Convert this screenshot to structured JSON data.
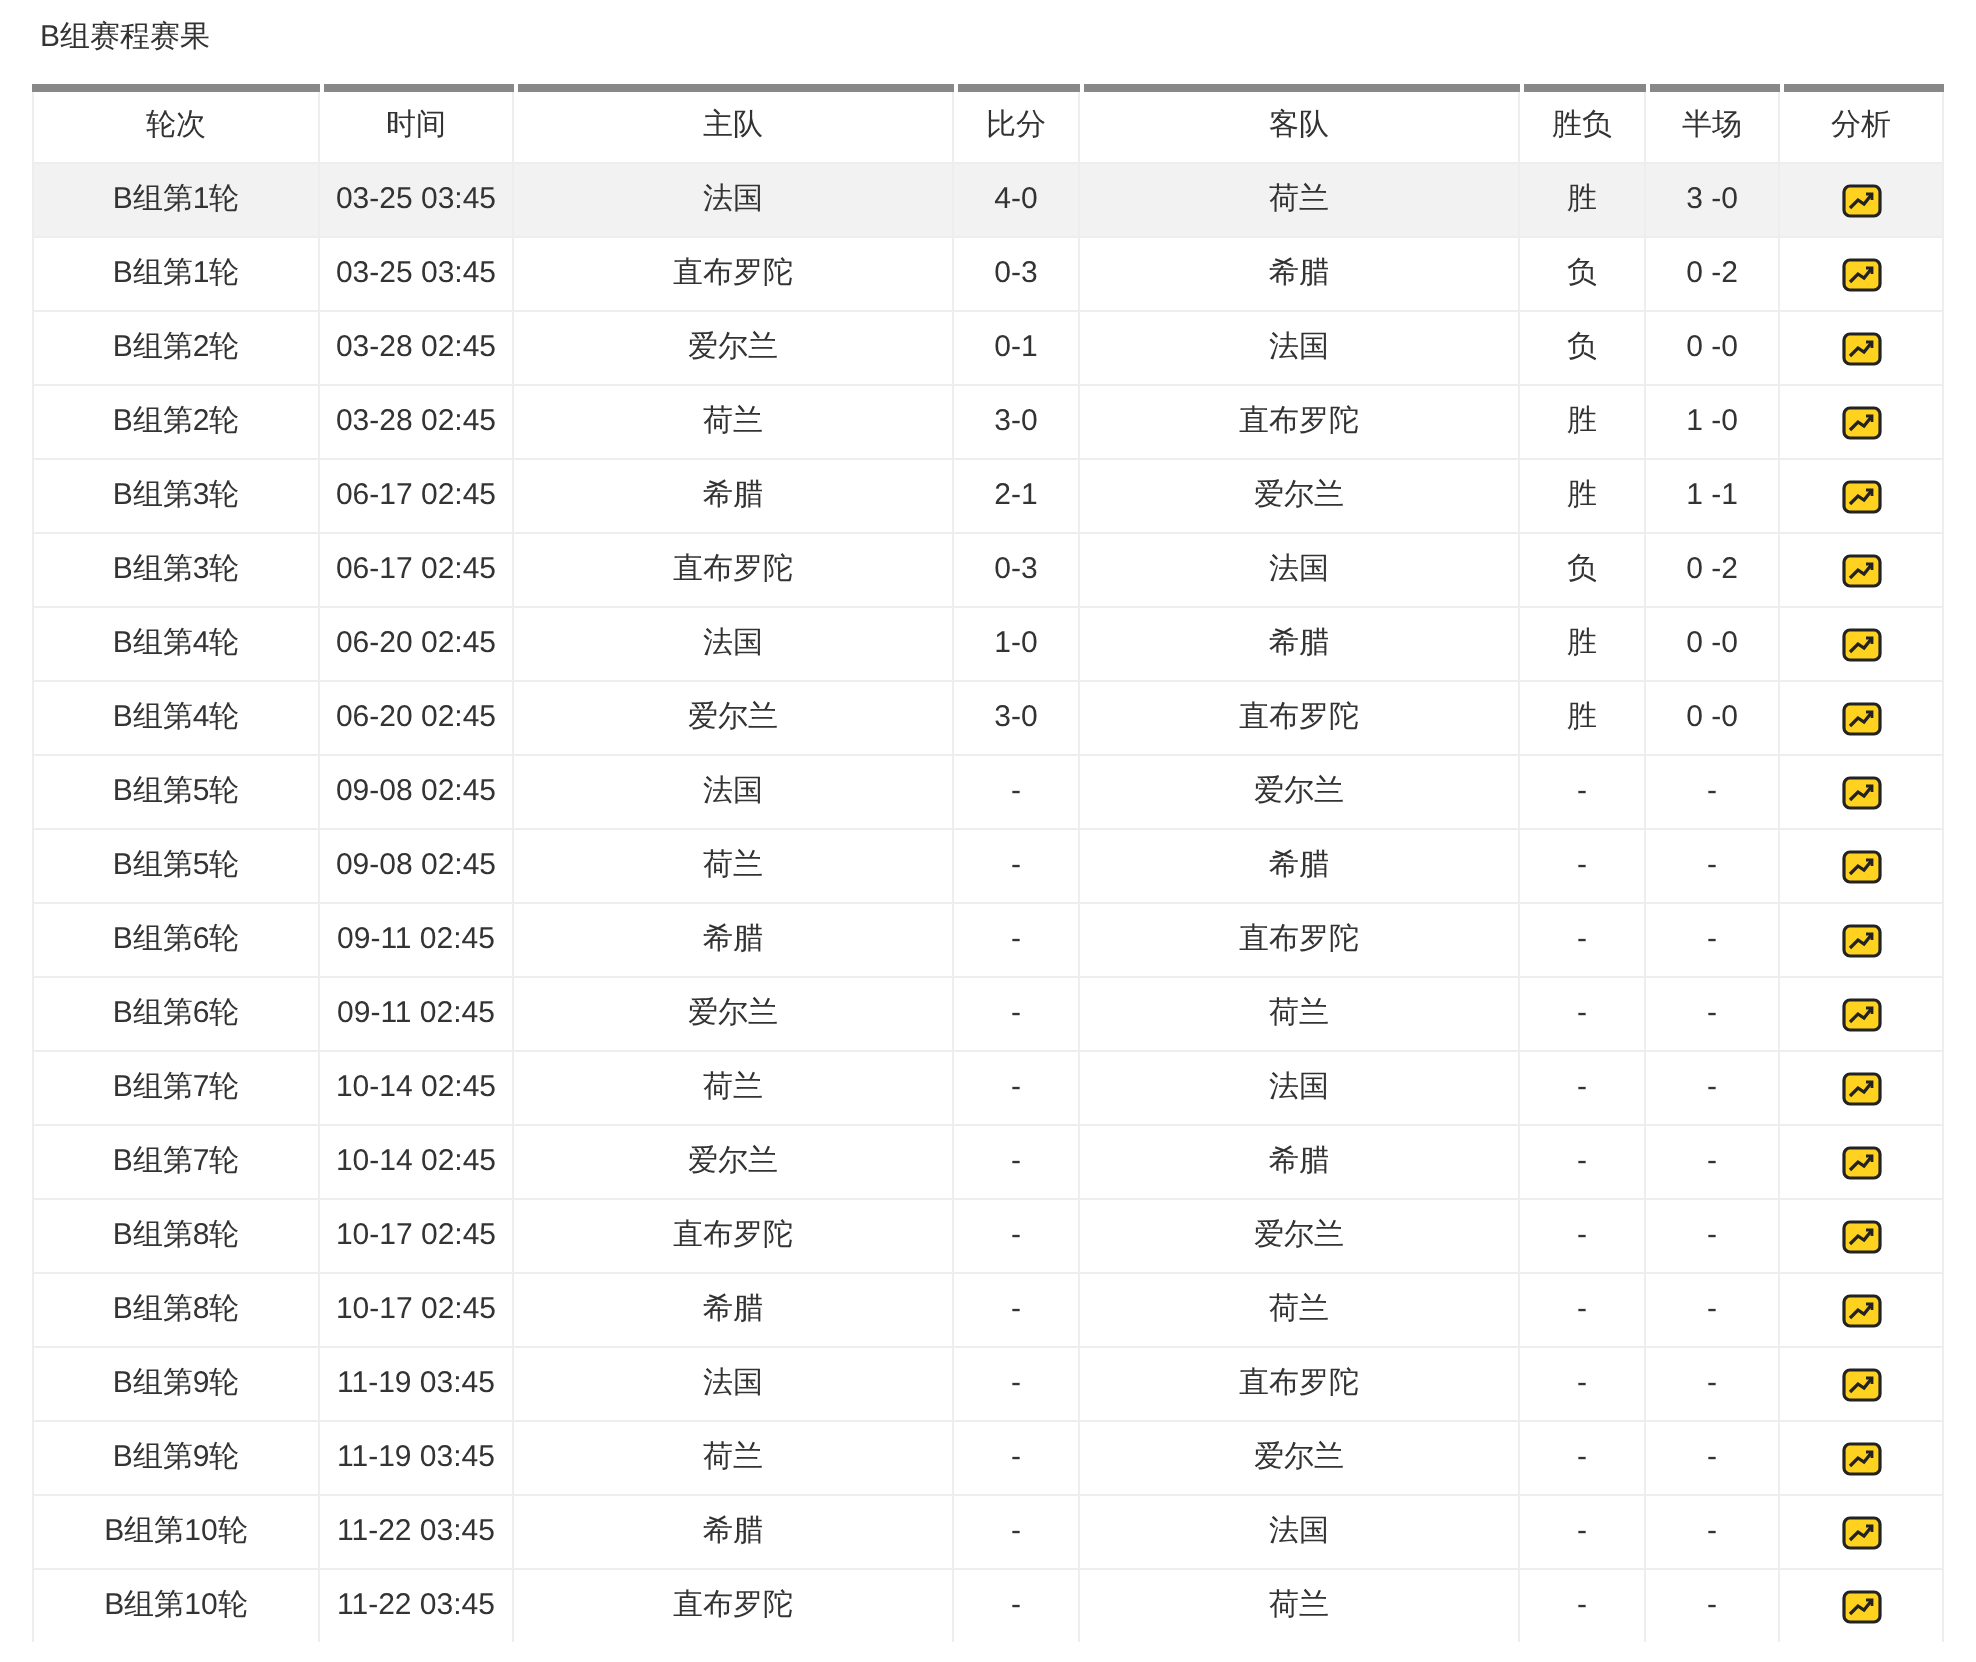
{
  "title": "B组赛程赛果",
  "table": {
    "columns": [
      "轮次",
      "时间",
      "主队",
      "比分",
      "客队",
      "胜负",
      "半场",
      "分析"
    ],
    "rows": [
      {
        "cells": [
          "B组第1轮",
          "03-25 03:45",
          "法国",
          "4-0",
          "荷兰",
          "胜",
          "3 -0"
        ],
        "selected": true
      },
      {
        "cells": [
          "B组第1轮",
          "03-25 03:45",
          "直布罗陀",
          "0-3",
          "希腊",
          "负",
          "0 -2"
        ],
        "selected": false
      },
      {
        "cells": [
          "B组第2轮",
          "03-28 02:45",
          "爱尔兰",
          "0-1",
          "法国",
          "负",
          "0 -0"
        ],
        "selected": false
      },
      {
        "cells": [
          "B组第2轮",
          "03-28 02:45",
          "荷兰",
          "3-0",
          "直布罗陀",
          "胜",
          "1 -0"
        ],
        "selected": false
      },
      {
        "cells": [
          "B组第3轮",
          "06-17 02:45",
          "希腊",
          "2-1",
          "爱尔兰",
          "胜",
          "1 -1"
        ],
        "selected": false
      },
      {
        "cells": [
          "B组第3轮",
          "06-17 02:45",
          "直布罗陀",
          "0-3",
          "法国",
          "负",
          "0 -2"
        ],
        "selected": false
      },
      {
        "cells": [
          "B组第4轮",
          "06-20 02:45",
          "法国",
          "1-0",
          "希腊",
          "胜",
          "0 -0"
        ],
        "selected": false
      },
      {
        "cells": [
          "B组第4轮",
          "06-20 02:45",
          "爱尔兰",
          "3-0",
          "直布罗陀",
          "胜",
          "0 -0"
        ],
        "selected": false
      },
      {
        "cells": [
          "B组第5轮",
          "09-08 02:45",
          "法国",
          "-",
          "爱尔兰",
          "-",
          "-"
        ],
        "selected": false
      },
      {
        "cells": [
          "B组第5轮",
          "09-08 02:45",
          "荷兰",
          "-",
          "希腊",
          "-",
          "-"
        ],
        "selected": false
      },
      {
        "cells": [
          "B组第6轮",
          "09-11 02:45",
          "希腊",
          "-",
          "直布罗陀",
          "-",
          "-"
        ],
        "selected": false
      },
      {
        "cells": [
          "B组第6轮",
          "09-11 02:45",
          "爱尔兰",
          "-",
          "荷兰",
          "-",
          "-"
        ],
        "selected": false
      },
      {
        "cells": [
          "B组第7轮",
          "10-14 02:45",
          "荷兰",
          "-",
          "法国",
          "-",
          "-"
        ],
        "selected": false
      },
      {
        "cells": [
          "B组第7轮",
          "10-14 02:45",
          "爱尔兰",
          "-",
          "希腊",
          "-",
          "-"
        ],
        "selected": false
      },
      {
        "cells": [
          "B组第8轮",
          "10-17 02:45",
          "直布罗陀",
          "-",
          "爱尔兰",
          "-",
          "-"
        ],
        "selected": false
      },
      {
        "cells": [
          "B组第8轮",
          "10-17 02:45",
          "希腊",
          "-",
          "荷兰",
          "-",
          "-"
        ],
        "selected": false
      },
      {
        "cells": [
          "B组第9轮",
          "11-19 03:45",
          "法国",
          "-",
          "直布罗陀",
          "-",
          "-"
        ],
        "selected": false
      },
      {
        "cells": [
          "B组第9轮",
          "11-19 03:45",
          "荷兰",
          "-",
          "爱尔兰",
          "-",
          "-"
        ],
        "selected": false
      },
      {
        "cells": [
          "B组第10轮",
          "11-22 03:45",
          "希腊",
          "-",
          "法国",
          "-",
          "-"
        ],
        "selected": false
      },
      {
        "cells": [
          "B组第10轮",
          "11-22 03:45",
          "直布罗陀",
          "-",
          "荷兰",
          "-",
          "-"
        ],
        "selected": false
      }
    ]
  }
}
